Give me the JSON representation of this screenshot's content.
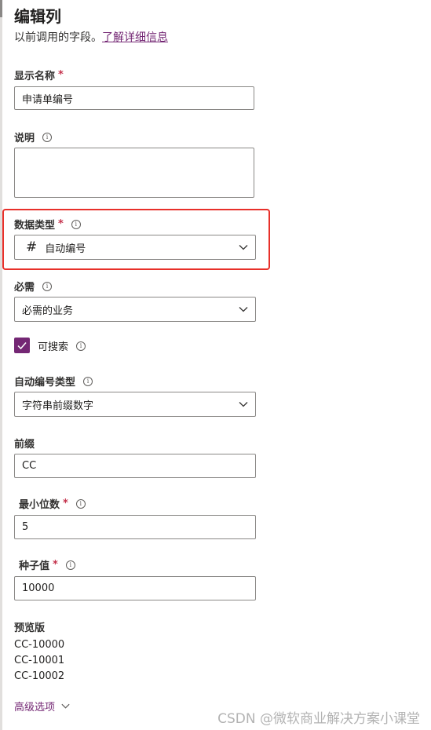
{
  "panel": {
    "title": "编辑列",
    "subtitle_text": "以前调用的字段。",
    "subtitle_link": "了解详细信息"
  },
  "display_name": {
    "label": "显示名称",
    "required_mark": "*",
    "value": "申请单编号"
  },
  "description": {
    "label": "说明",
    "value": ""
  },
  "data_type": {
    "label": "数据类型",
    "required_mark": "*",
    "icon_glyph": "#",
    "value": "自动编号"
  },
  "required": {
    "label": "必需",
    "value": "必需的业务"
  },
  "searchable": {
    "label": "可搜索",
    "checked": true
  },
  "autonumber_type": {
    "label": "自动编号类型",
    "value": "字符串前缀数字"
  },
  "prefix": {
    "label": "前缀",
    "value": "CC"
  },
  "min_digits": {
    "label": "最小位数",
    "required_mark": "*",
    "value": "5"
  },
  "seed": {
    "label": "种子值",
    "required_mark": "*",
    "value": "10000"
  },
  "preview": {
    "label": "预览版",
    "values": [
      "CC-10000",
      "CC-10001",
      "CC-10002"
    ]
  },
  "advanced": {
    "label": "高级选项"
  },
  "watermark": "CSDN @微软商业解决方案小课堂",
  "colors": {
    "accent": "#742774",
    "required": "#c4314b",
    "highlight": "#e8302a"
  },
  "icons": {
    "info": "info-icon",
    "chevron": "chevron-down-icon",
    "check": "checkmark-icon"
  }
}
